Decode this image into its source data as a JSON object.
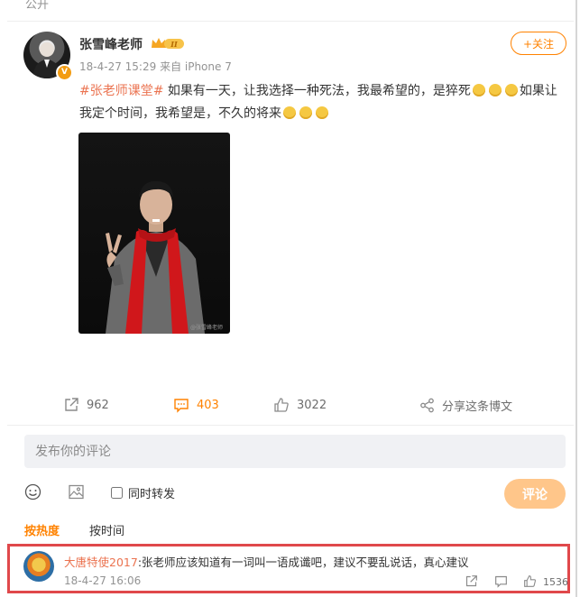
{
  "top": {
    "visibility_label": "公开"
  },
  "post": {
    "author": "张雪峰老师",
    "timestamp": "18-4-27 15:29",
    "source": "来自 iPhone 7",
    "follow_label": "+关注",
    "hashtag": "#张老师课堂#",
    "text_part1": " 如果有一天，让我选择一种死法，我最希望的，是猝死",
    "text_part2": "如果让我定个时间，我希望是，不久的将来",
    "photo_watermark": "@张雪峰老师"
  },
  "actions": {
    "repost_count": "962",
    "comment_count": "403",
    "like_count": "3022",
    "share_label": "分享这条博文"
  },
  "composer": {
    "placeholder": "发布你的评论",
    "repost_label": "同时转发",
    "submit_label": "评论"
  },
  "sort": {
    "hot_label": "按热度",
    "time_label": "按时间"
  },
  "comment": {
    "user": "大唐特使2017",
    "text": ":张老师应该知道有一词叫一语成谶吧，建议不要乱说话，真心建议",
    "time": "18-4-27 16:06",
    "like_count": "1536"
  },
  "colors": {
    "accent": "#ff8200",
    "link": "#eb7350",
    "highlight_border": "#e0484b"
  }
}
